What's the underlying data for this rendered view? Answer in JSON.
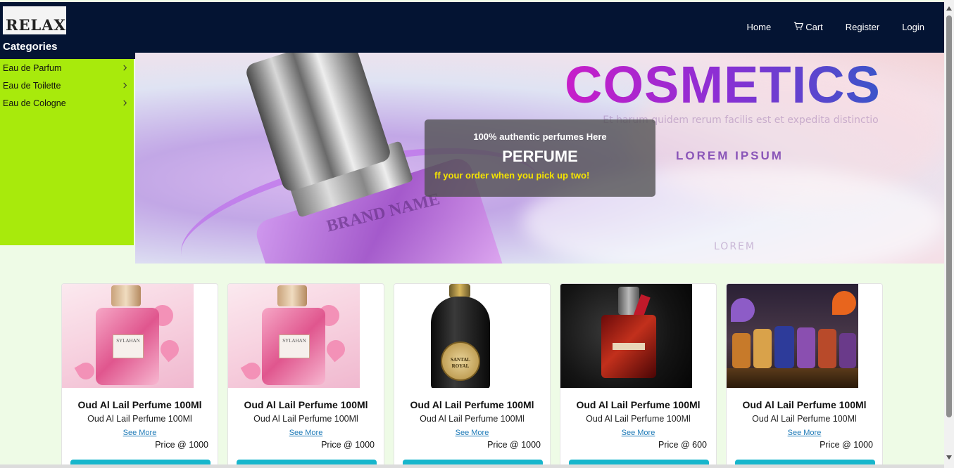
{
  "brand": {
    "logo_text": "RELAX"
  },
  "nav": {
    "home": "Home",
    "cart": "Cart",
    "register": "Register",
    "login": "Login"
  },
  "sidebar": {
    "title": "Categories",
    "items": [
      {
        "label": "Eau de Parfum"
      },
      {
        "label": "Eau de Toilette"
      },
      {
        "label": "Eau de Cologne"
      }
    ]
  },
  "hero": {
    "banner_title": "COSMETICS",
    "banner_subtitle": "LOREM IPSUM",
    "banner_faint_text": "Et harum quidem rerum facilis est et expedita distinctio",
    "banner_faint_lorem": "LOREM",
    "bottle_text": "BRAND NAME",
    "overlay_tag": "100% authentic perfumes Here",
    "overlay_title": "PERFUME",
    "overlay_promo": "ff your order when you pick up two!"
  },
  "products": [
    {
      "name": "Oud Al Lail Perfume 100Ml",
      "desc": "Oud Al Lail Perfume 100Ml",
      "link": "See More",
      "price": "Price @ 1000",
      "image": "pink-floral-perfume"
    },
    {
      "name": "Oud Al Lail Perfume 100Ml",
      "desc": "Oud Al Lail Perfume 100Ml",
      "link": "See More",
      "price": "Price @ 1000",
      "image": "pink-floral-perfume"
    },
    {
      "name": "Oud Al Lail Perfume 100Ml",
      "desc": "Oud Al Lail Perfume 100Ml",
      "link": "See More",
      "price": "Price @ 1000",
      "image": "black-santal-royal-perfume"
    },
    {
      "name": "Oud Al Lail Perfume 100Ml",
      "desc": "Oud Al Lail Perfume 100Ml",
      "link": "See More",
      "price": "Price @ 600",
      "image": "red-perfume-dark-background"
    },
    {
      "name": "Oud Al Lail Perfume 100Ml",
      "desc": "Oud Al Lail Perfume 100Ml",
      "link": "See More",
      "price": "Price @ 1000",
      "image": "colorful-perfume-collection"
    }
  ],
  "labels": {
    "pink_bottle": "SYLAHAN",
    "black_bottle": "SANTAL ROYAL"
  },
  "colors": {
    "navbar": "#041433",
    "sidebar": "#a8ea0c",
    "page_bg": "#eefbe6",
    "button": "#17b6cc",
    "link": "#1f7bb8",
    "promo": "#f5e400"
  }
}
